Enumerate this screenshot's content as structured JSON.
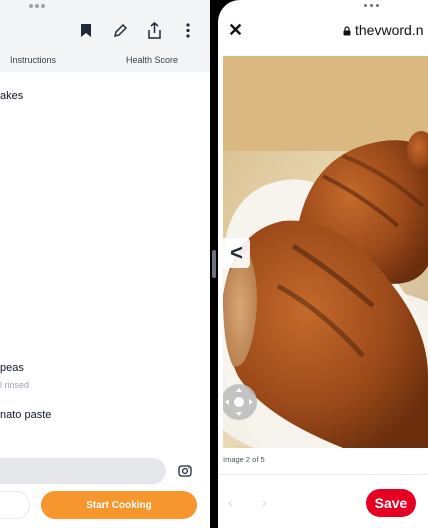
{
  "left_app": {
    "tabs": [
      "Instructions",
      "Health Score"
    ],
    "ingredients": [
      {
        "line": "akes",
        "sub": ""
      },
      {
        "line": "peas",
        "sub": "l rinsed"
      },
      {
        "line": "nato paste",
        "sub": ""
      }
    ],
    "start_button": "Start Cooking",
    "icons": [
      "bookmark-icon",
      "pencil-icon",
      "share-icon",
      "more-vertical-icon",
      "camera-icon"
    ],
    "accent_color": "#f7962d"
  },
  "browser": {
    "url": "thevword.n",
    "caption": "Image 2 of 5",
    "save_label": "Save",
    "close_icon": "close-icon",
    "prev_arrow": "<",
    "save_color": "#e60023"
  }
}
